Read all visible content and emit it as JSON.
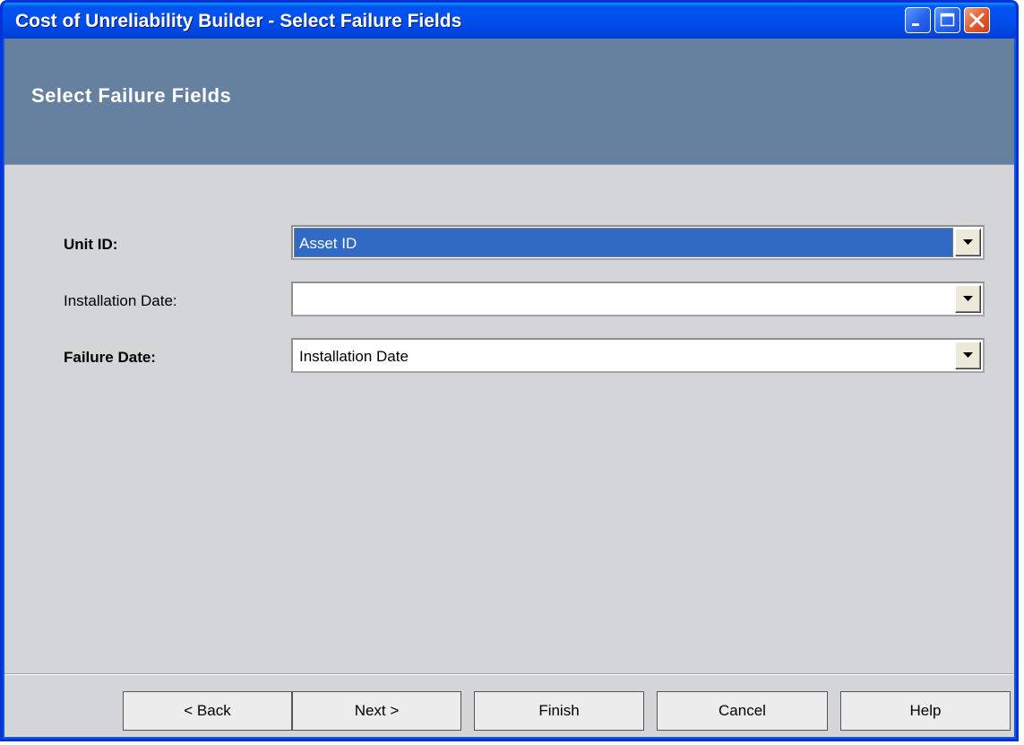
{
  "window": {
    "title": "Cost of Unreliability Builder - Select Failure Fields",
    "controls": [
      "minimize-icon",
      "maximize-icon",
      "close-icon"
    ]
  },
  "header": {
    "title": "Select Failure Fields"
  },
  "form": {
    "unit_id": {
      "label": "Unit ID:",
      "value": "Asset ID",
      "selected": true
    },
    "installation_date": {
      "label": "Installation Date:",
      "value": ""
    },
    "failure_date": {
      "label": "Failure Date:",
      "value": "Installation Date"
    }
  },
  "buttons": {
    "back": "< Back",
    "next": "Next >",
    "finish": "Finish",
    "cancel": "Cancel",
    "help": "Help"
  },
  "colors": {
    "titlebar": "#0053ee",
    "header": "#66809f",
    "client": "#d4d5d9",
    "selection": "#316ac5"
  }
}
